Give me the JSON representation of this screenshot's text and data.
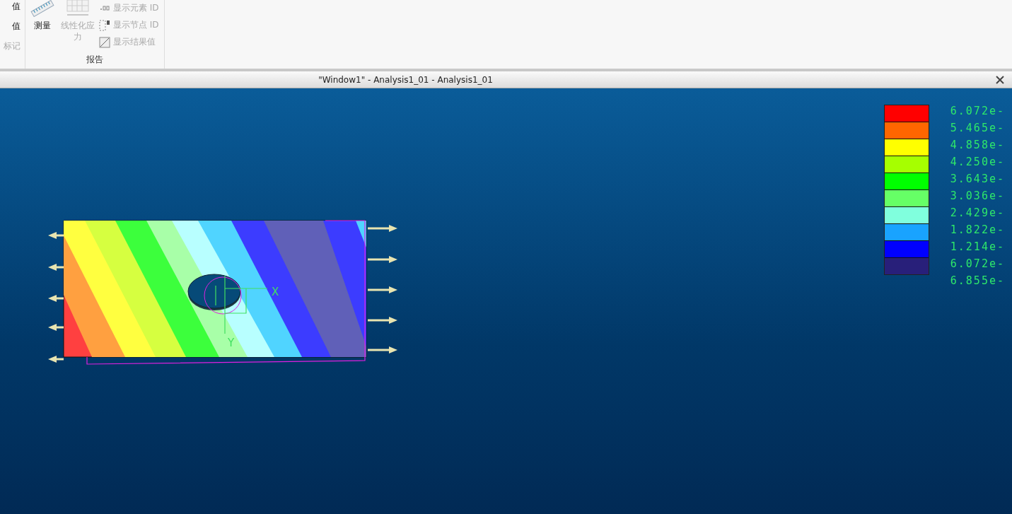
{
  "ribbon": {
    "left_column": [
      {
        "label": "值",
        "disabled": false
      },
      {
        "label": "值",
        "disabled": false
      },
      {
        "label": "标记",
        "disabled": true
      }
    ],
    "large_buttons": [
      {
        "label": "测量",
        "kind": "ruler",
        "disabled": false
      },
      {
        "label": "线性化应力",
        "kind": "grid",
        "disabled": true
      }
    ],
    "small_buttons": [
      {
        "label": "显示元素 ID",
        "kind": "decimal",
        "disabled": true
      },
      {
        "label": "显示节点 ID",
        "kind": "node",
        "disabled": true
      },
      {
        "label": "显示结果值",
        "kind": "result",
        "disabled": true
      }
    ],
    "group_label": "报告"
  },
  "window": {
    "title": "\"Window1\" - Analysis1_01 - Analysis1_01"
  },
  "plot": {
    "axis_x": "X",
    "axis_y": "Y"
  },
  "legend": [
    {
      "label": "6.072e-",
      "color": "#ff0000"
    },
    {
      "label": "5.465e-",
      "color": "#ff6600"
    },
    {
      "label": "4.858e-",
      "color": "#ffff00"
    },
    {
      "label": "4.250e-",
      "color": "#a6ff00"
    },
    {
      "label": "3.643e-",
      "color": "#00ff00"
    },
    {
      "label": "3.036e-",
      "color": "#66ff66"
    },
    {
      "label": "2.429e-",
      "color": "#80ffdd"
    },
    {
      "label": "1.822e-",
      "color": "#19a3ff"
    },
    {
      "label": "1.214e-",
      "color": "#0000ff"
    },
    {
      "label": "6.072e-",
      "color": "#281f7a"
    },
    {
      "label": "6.855e-"
    }
  ]
}
